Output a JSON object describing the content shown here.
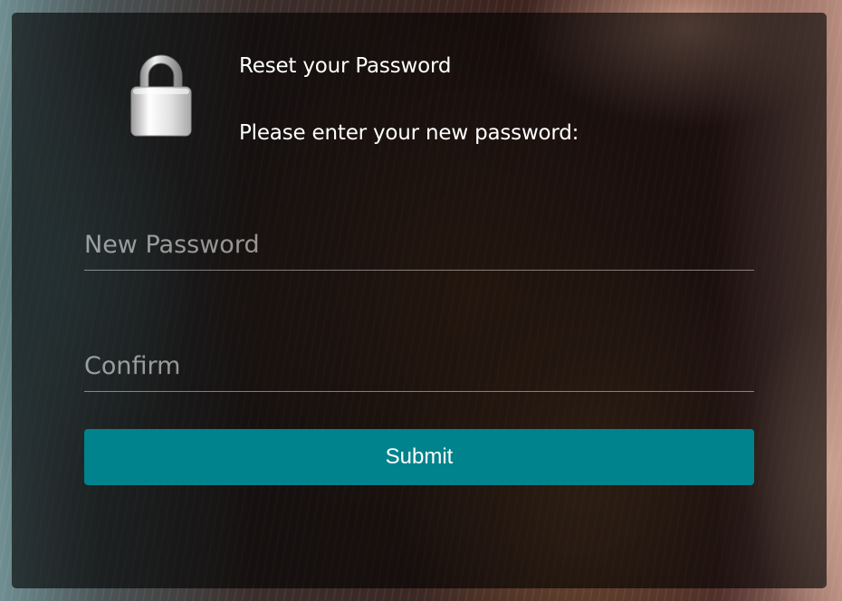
{
  "card": {
    "title": "Reset your Password",
    "subtitle": "Please enter your new password:"
  },
  "form": {
    "new_password": {
      "placeholder": "New Password",
      "value": ""
    },
    "confirm": {
      "placeholder": "Confirm",
      "value": ""
    },
    "submit_label": "Submit"
  },
  "colors": {
    "submit_button": "#00838c",
    "overlay": "rgba(0,0,0,0.62)",
    "text": "#ffffff"
  },
  "icons": {
    "lock": "lock-icon"
  }
}
